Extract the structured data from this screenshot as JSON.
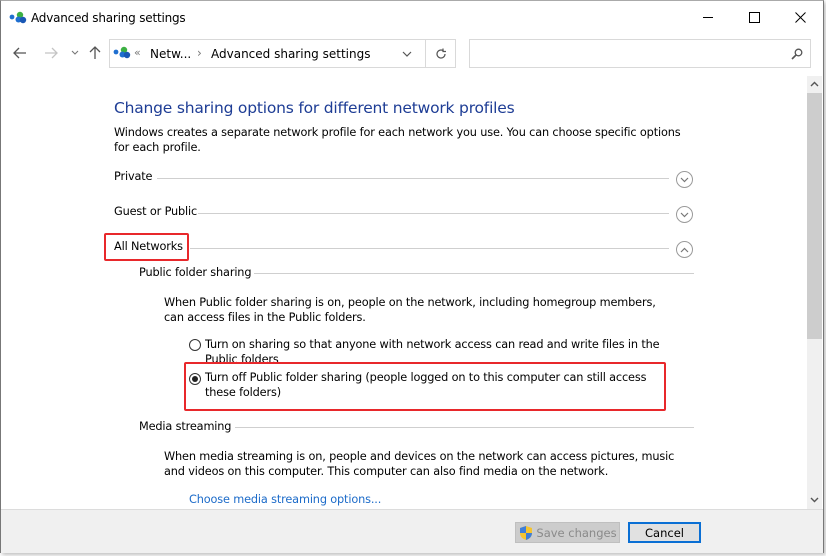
{
  "window": {
    "title": "Advanced sharing settings",
    "controls": {
      "minimize": "minimize-icon",
      "maximize": "maximize-icon",
      "close": "close-icon"
    }
  },
  "nav": {
    "back": "back-arrow-icon",
    "forward": "forward-arrow-icon",
    "recent": "chevron-down-icon",
    "up": "up-arrow-icon"
  },
  "address": {
    "overflow": "«",
    "crumbs": [
      "Netw...",
      "Advanced sharing settings"
    ],
    "separator": "›"
  },
  "search": {
    "placeholder": "",
    "value": ""
  },
  "main": {
    "heading": "Change sharing options for different network profiles",
    "intro": "Windows creates a separate network profile for each network you use. You can choose specific options for each profile.",
    "profiles": [
      {
        "label": "Private",
        "state": "collapsed"
      },
      {
        "label": "Guest or Public",
        "state": "collapsed"
      },
      {
        "label": "All Networks",
        "state": "expanded",
        "highlighted": true
      }
    ],
    "public_folder": {
      "title": "Public folder sharing",
      "description": "When Public folder sharing is on, people on the network, including homegroup members, can access files in the Public folders.",
      "options": [
        {
          "label": "Turn on sharing so that anyone with network access can read and write files in the Public folders",
          "selected": false
        },
        {
          "label": "Turn off Public folder sharing (people logged on to this computer can still access these folders)",
          "selected": true,
          "highlighted": true
        }
      ]
    },
    "media": {
      "title": "Media streaming",
      "description": "When media streaming is on, people and devices on the network can access pictures, music and videos on this computer. This computer can also find media on the network.",
      "link": "Choose media streaming options..."
    }
  },
  "footer": {
    "save": "Save changes",
    "cancel": "Cancel"
  },
  "colors": {
    "heading": "#1e3d95",
    "link": "#1c6bc9",
    "highlight": "#e8282b",
    "focus": "#0a6fd4"
  }
}
